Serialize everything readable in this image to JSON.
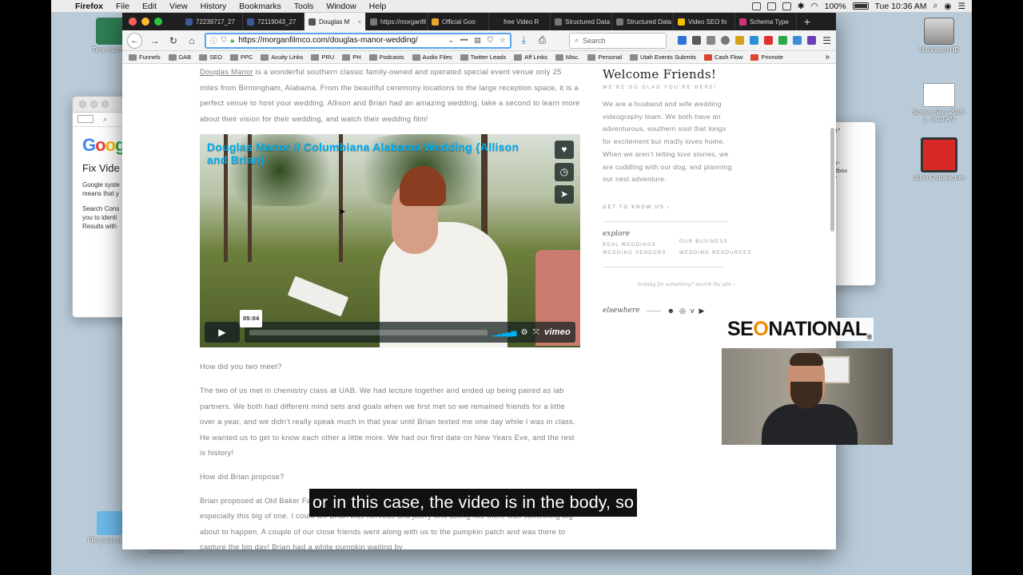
{
  "menubar": {
    "app": "Firefox",
    "menus": [
      "File",
      "Edit",
      "View",
      "History",
      "Bookmarks",
      "Tools",
      "Window",
      "Help"
    ],
    "battery": "100%",
    "clock": "Tue 10:36 AM"
  },
  "desktop": {
    "icons": {
      "time_machine": "Time Mach...",
      "macintosh_hd": "Macintosh HD",
      "screenshot": "Screen Shot 2018-1...9.10 AM",
      "video_trec": "video-Outrank.trec",
      "fb_group": "FB group audits",
      "truncated": "Local_Does"
    },
    "google_window": {
      "logo": "Goog",
      "heading": "Fix Vide",
      "line1": "Google syste",
      "line2": "means that y",
      "line3": "Search Cons",
      "line4": "you to identi",
      "line5": "Results with"
    },
    "code_window": {
      "line1": "5863\"",
      "line2": "llow-",
      "line3": "sandbox",
      "line4": "\"..\""
    }
  },
  "browser": {
    "tabs": [
      {
        "label": "72239717_27",
        "color": "#3b5998"
      },
      {
        "label": "72119043_27",
        "color": "#3b5998"
      },
      {
        "label": "Douglas M",
        "color": "#555555"
      },
      {
        "label": "https://morganfil",
        "color": "#777777"
      },
      {
        "label": "Official Goo",
        "color": "#e8a32a"
      },
      {
        "label": "free Video R",
        "color": "#222222"
      },
      {
        "label": "Structured Data",
        "color": "#777777"
      },
      {
        "label": "Structured Data",
        "color": "#777777"
      },
      {
        "label": "Video SEO fo",
        "color": "#f0c000"
      },
      {
        "label": "Schema Type",
        "color": "#d2317a"
      }
    ],
    "active_tab": 2,
    "url": "https://morganfilmco.com/douglas-manor-wedding/",
    "search_placeholder": "Search",
    "bookmarks": [
      "Funnels",
      "DAB",
      "SEO",
      "PPC",
      "Acuity Links",
      "PRU",
      "PH",
      "Podcasts",
      "Audio Files",
      "Twitter Leads",
      "Aff Links",
      "Misc.",
      "Personal",
      "Utah Events Submits",
      "Cash Flow",
      "Privnote"
    ]
  },
  "article": {
    "intro_link": "Douglas Manor",
    "intro_rest": " is a wonderful southern classic family-owned and operated special event venue only 25 miles from Birmingham, Alabama. From the beautiful ceremony locations to the large reception space, it is a perfect venue to host your wedding. Allison and Brian had an amazing wedding, take a second to learn more about their vision for their wedding, and watch their wedding film!",
    "video": {
      "title": "Douglas Manor // Columbiana Alabama Wedding {Allison and Brian}",
      "duration": "05:04",
      "brand": "vimeo"
    },
    "q1": "How did you two meet?",
    "a1": "The two of us met in chemistry class at UAB. We had lecture together and ended up being paired as lab partners. We both had different mind sets and goals when we first met so we remained friends for a little over a year, and we didn't really speak much in that year until Brian texted me one day while I was in class. He wanted us to get to know each other a little more. We had our first date on New Years Eve, and the rest is history!",
    "q2": "How did Brian propose?",
    "a2": "Brian proposed at Old Baker Farm. I was a complete surprise. Brian is not the best with hiding secrets, especially this big of one. I could tell Brian was nervous and jittery and acting like there was something big about to happen. A couple of our close friends went along with us to the pumpkin patch and was there to capture the big day! Brian had a white pumpkin waiting by"
  },
  "sidebar": {
    "title": "Welcome Friends!",
    "subtitle": "WE'RE SO GLAD YOU'RE HERE!",
    "body": "We are a husband and wife wedding videography team. We both have an adventurous, southern soul that longs for excitement but madly loves home. When we aren't telling love stories, we are cuddling with our dog, and planning our next adventure.",
    "cta": "GET TO KNOW US",
    "explore": "explore",
    "links": [
      "REAL WEDDINGS",
      "OUR BUSINESS",
      "WEDDING VENDORS",
      "WEDDING RESOURCES"
    ],
    "search_hint": "looking for something? search the site",
    "elsewhere": "elsewhere"
  },
  "overlay": {
    "logo_se": "SE",
    "logo_o": "O",
    "logo_rest": "NATIONAL",
    "logo_reg": "®",
    "caption": "or  in this case, the video is in the body, so"
  }
}
